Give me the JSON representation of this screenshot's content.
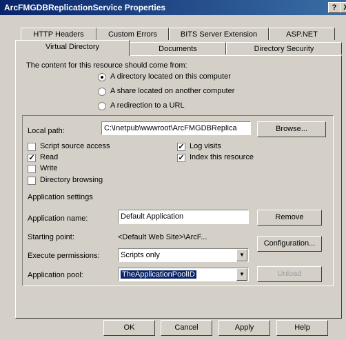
{
  "window": {
    "title": "ArcFMGDBReplicationService Properties",
    "help_btn": "?",
    "close_btn": "X"
  },
  "tabs": {
    "row1": [
      "HTTP Headers",
      "Custom Errors",
      "BITS Server Extension",
      "ASP.NET"
    ],
    "row2": [
      "Virtual Directory",
      "Documents",
      "Directory Security"
    ]
  },
  "content": {
    "heading": "The content for this resource should come from:",
    "options": [
      {
        "label": "A directory located on this computer",
        "selected": true
      },
      {
        "label": "A share located on another computer",
        "selected": false
      },
      {
        "label": "A redirection to a URL",
        "selected": false
      }
    ]
  },
  "local_path": {
    "label": "Local path:",
    "value": "C:\\Inetpub\\wwwroot\\ArcFMGDBReplica",
    "browse_btn": "Browse..."
  },
  "checkboxes": {
    "script_source": {
      "label": "Script source access",
      "checked": false
    },
    "read": {
      "label": "Read",
      "checked": true
    },
    "write": {
      "label": "Write",
      "checked": false
    },
    "dir_browsing": {
      "label": "Directory browsing",
      "checked": false
    },
    "log_visits": {
      "label": "Log visits",
      "checked": true
    },
    "index_resource": {
      "label": "Index this resource",
      "checked": true
    }
  },
  "app_settings": {
    "heading": "Application settings",
    "name_label": "Application name:",
    "name_value": "Default Application",
    "remove_btn": "Remove",
    "start_label": "Starting point:",
    "start_value": "<Default Web Site>\\ArcF...",
    "config_btn": "Configuration...",
    "exec_label": "Execute permissions:",
    "exec_value": "Scripts only",
    "pool_label": "Application pool:",
    "pool_value": "TheApplicationPoolID",
    "unload_btn": "Unload"
  },
  "footer": {
    "ok": "OK",
    "cancel": "Cancel",
    "apply": "Apply",
    "help": "Help"
  }
}
